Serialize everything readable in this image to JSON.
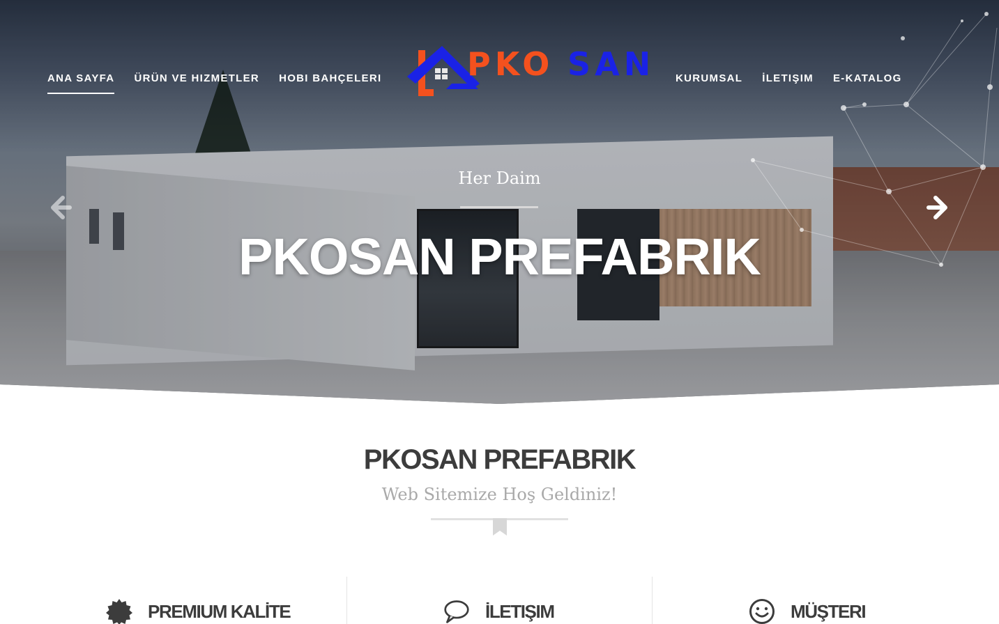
{
  "nav": {
    "left": [
      {
        "label": "ANA SAYFA",
        "active": true
      },
      {
        "label": "ÜRÜN VE HIZMETLER"
      },
      {
        "label": "HOBI BAHÇELERI"
      }
    ],
    "right": [
      {
        "label": "KURUMSAL"
      },
      {
        "label": "İLETIŞIM"
      },
      {
        "label": "E-KATALOG"
      }
    ]
  },
  "logo": {
    "text_orange": "PKO",
    "text_blue": "SAN",
    "colors": {
      "orange": "#f4511e",
      "blue": "#1a22e6"
    }
  },
  "hero": {
    "kicker": "Her Daim",
    "title": "PKOSAN PREFABRIK",
    "prev_icon": "arrow-left-icon",
    "next_icon": "arrow-right-icon"
  },
  "welcome": {
    "title": "PKOSAN PREFABRIK",
    "subtitle": "Web Sitemize Hoş Geldiniz!"
  },
  "features": [
    {
      "label": "PREMIUM KALİTE",
      "icon": "badge-icon"
    },
    {
      "label": "İLETIŞIM",
      "icon": "speech-bubble-icon"
    },
    {
      "label": "MÜŞTERI",
      "icon": "smiley-icon"
    }
  ]
}
